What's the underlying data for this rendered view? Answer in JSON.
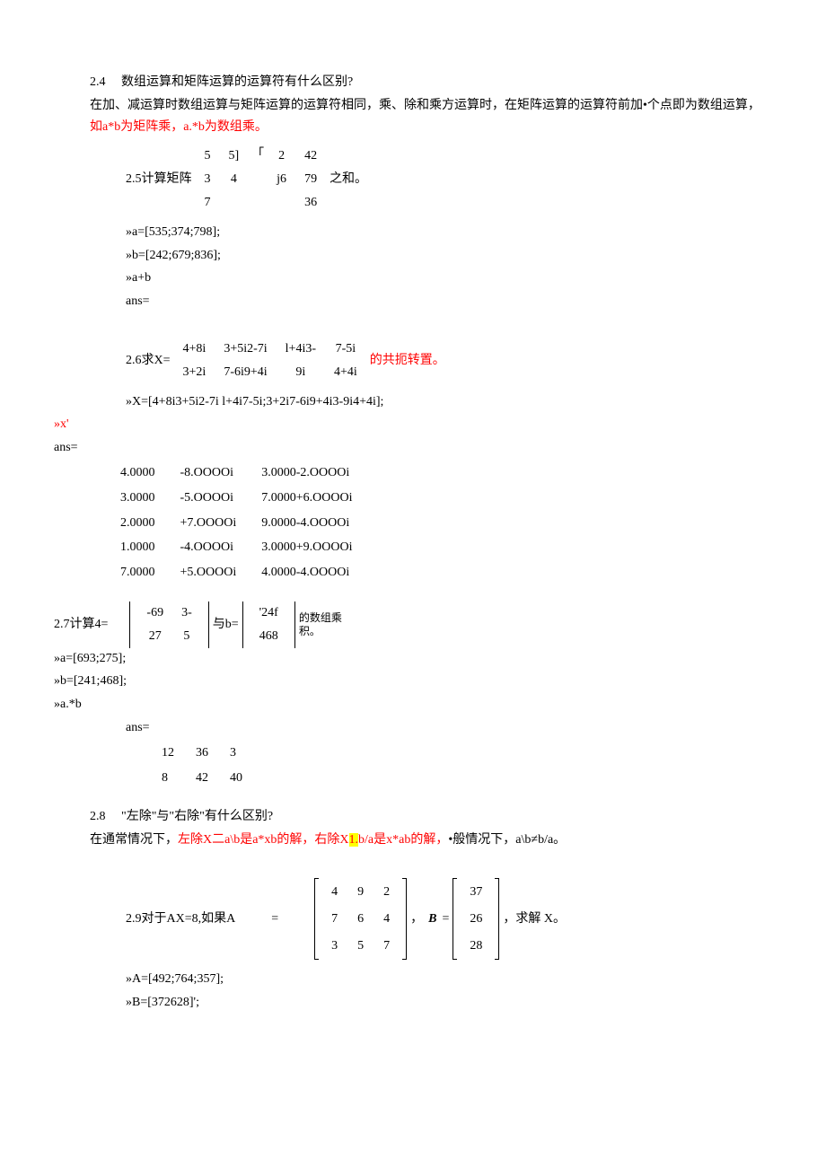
{
  "q24": {
    "title": "2.4　 数组运算和矩阵运算的运算符有什么区别?",
    "ans_pre": "在加、减运算时数组运算与矩阵运算的运算符相同，乘、除和乘方运算时，在矩阵运算的运算符前加•个点即为数组运算，",
    "ans_red": "如a*b为矩阵乘，a.*b为数组乘。"
  },
  "q25": {
    "label_pre": "2.5计算矩阵",
    "mat1": [
      [
        "5",
        "5]"
      ],
      [
        "3",
        "4"
      ],
      [
        "7",
        ""
      ]
    ],
    "bracket": "「",
    "mat2": [
      [
        "2",
        "42"
      ],
      [
        "j6",
        "79"
      ],
      [
        "",
        "36"
      ]
    ],
    "label_post": "之和。",
    "code": [
      "»a=[535;374;798];",
      "»b=[242;679;836];",
      "»a+b",
      "ans="
    ]
  },
  "q26": {
    "label_pre": "2.6求X=",
    "row1": [
      "4+8i",
      "3+5i2-7i",
      "l+4i3-",
      "7-5i"
    ],
    "row2": [
      "3+2i",
      "7-6i9+4i",
      "9i",
      "4+4i"
    ],
    "label_post_red": "的共扼转置。",
    "code": "»X=[4+8i3+5i2-7i l+4i7-5i;3+2i7-6i9+4i3-9i4+4i];",
    "xprime": "»x'",
    "anslabel": "ans=",
    "ans": [
      [
        "4.0000",
        "-8.OOOOi",
        "3.0000-2.OOOOi"
      ],
      [
        "3.0000",
        "-5.OOOOi",
        "7.0000+6.OOOOi"
      ],
      [
        "2.0000",
        "+7.OOOOi",
        "9.0000-4.OOOOi"
      ],
      [
        "1.0000",
        "-4.OOOOi",
        "3.0000+9.OOOOi"
      ],
      [
        "7.0000",
        "+5.OOOOi",
        "4.0000-4.OOOOi"
      ]
    ]
  },
  "q27": {
    "label_pre": "2.7计算4=",
    "matA": [
      [
        "-69",
        "3-"
      ],
      [
        "27",
        "5"
      ]
    ],
    "mid": "与b=",
    "matB": [
      [
        "'24f"
      ],
      [
        "468"
      ]
    ],
    "label_post": "的数组乘\n积。",
    "code": [
      "»a=[693;275];",
      "»b=[241;468];",
      "»a.*b"
    ],
    "anslabel": "ans=",
    "ans": [
      [
        "12",
        "36",
        "3"
      ],
      [
        "8",
        "42",
        "40"
      ]
    ]
  },
  "q28": {
    "title": "2.8　 \"左除\"与\"右除\"有什么区别?",
    "pre": "在通常情况下，",
    "red1": "左除X二a\\b是a*xb的解，右除X",
    "hl": "1.",
    "red2": "b/a是x*ab的解，",
    "post": "•般情况下，a\\b≠b/a。"
  },
  "q29": {
    "label_pre": "2.9对于AX=8,如果A",
    "eq": "=",
    "A": [
      [
        "4",
        "9",
        "2"
      ],
      [
        "7",
        "6",
        "4"
      ],
      [
        "3",
        "5",
        "7"
      ]
    ],
    "comma": "，",
    "Blabel": "B",
    "eq2": "=",
    "B": [
      [
        "37"
      ],
      [
        "26"
      ],
      [
        "28"
      ]
    ],
    "post": "，求解 X。",
    "code": [
      "»A=[492;764;357];",
      "»B=[372628]';"
    ]
  }
}
